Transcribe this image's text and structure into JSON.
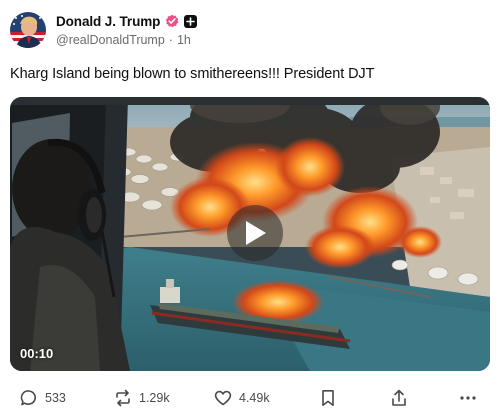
{
  "author": {
    "display_name": "Donald J. Trump",
    "handle": "@realDonaldTrump",
    "separator": "·",
    "time_ago": "1h"
  },
  "post": {
    "text": "Kharg Island being blown to smithereens!!! President DJT"
  },
  "media": {
    "type": "video",
    "duration": "00:10"
  },
  "actions": {
    "replies": "533",
    "retruths": "1.29k",
    "likes": "4.49k"
  },
  "icons": {
    "verified": "verified-badge-icon",
    "follow": "plus-icon",
    "play": "play-icon",
    "reply": "comment-icon",
    "retruth": "repost-icon",
    "like": "heart-icon",
    "bookmark": "bookmark-icon",
    "share": "share-icon",
    "more": "more-icon"
  },
  "colors": {
    "verified": "#e8508a",
    "text": "#0f0f0f",
    "muted": "#6b6b6b",
    "fire": "#f5821f",
    "smoke": "#2c2a28",
    "sea": "#3f7f8c"
  }
}
